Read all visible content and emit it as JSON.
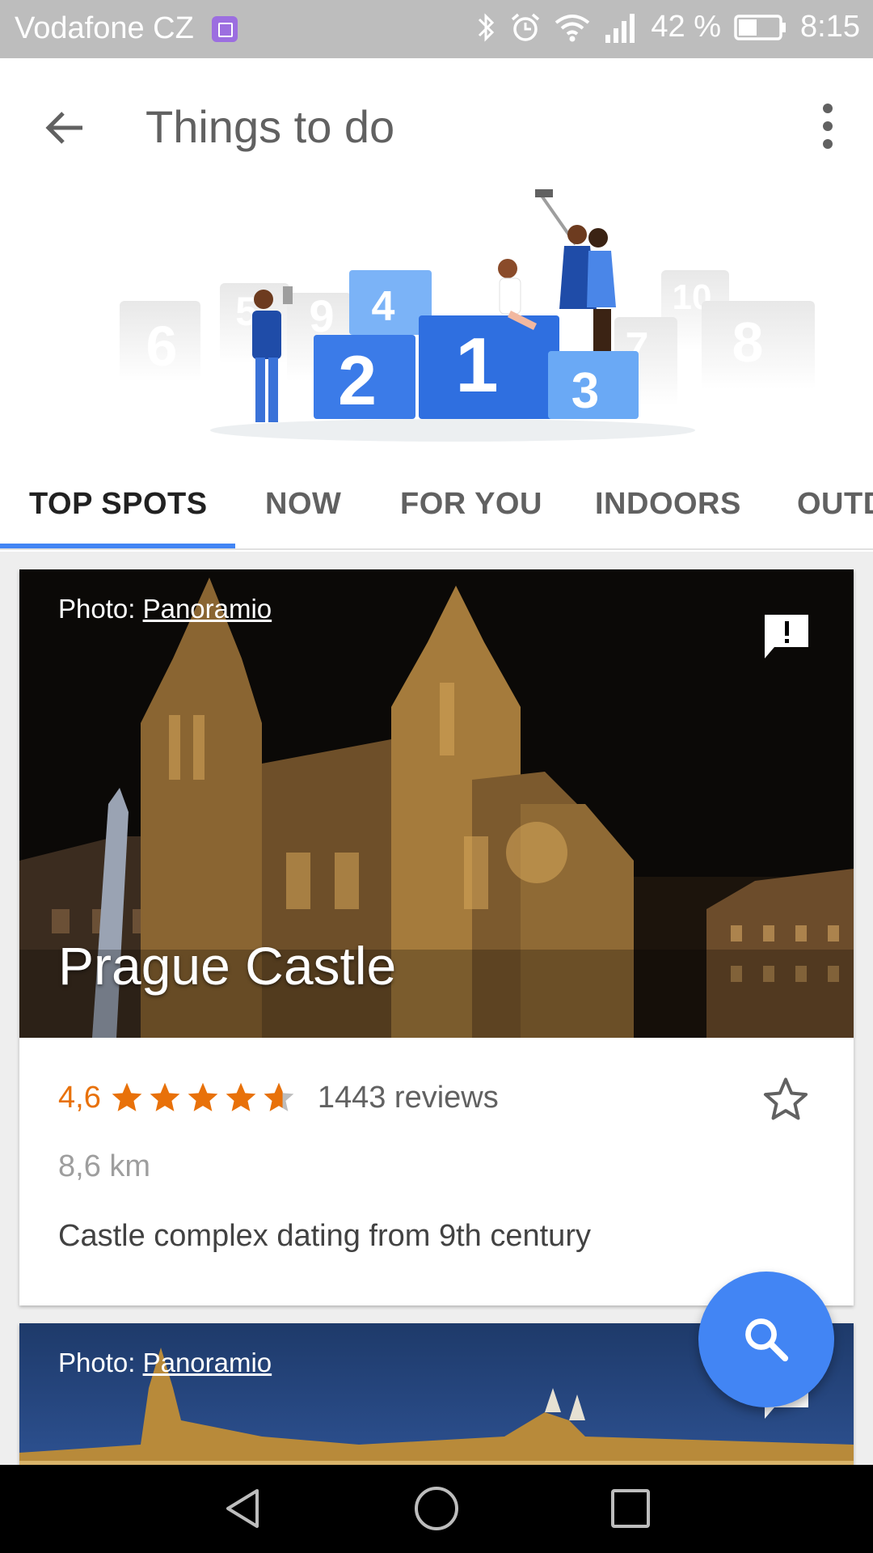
{
  "status_bar": {
    "carrier": "Vodafone CZ",
    "battery_percent": "42 %",
    "time": "8:15",
    "icons": [
      "gallery-icon",
      "bluetooth-icon",
      "alarm-icon",
      "wifi-icon",
      "signal-icon",
      "battery-icon"
    ]
  },
  "app_bar": {
    "title": "Things to do",
    "back_icon": "arrow-back-icon",
    "menu_icon": "more-vert-icon"
  },
  "hero": {
    "podium_numbers": [
      "1",
      "2",
      "3",
      "4",
      "5",
      "6",
      "7",
      "8",
      "9",
      "10"
    ]
  },
  "tabs": {
    "items": [
      {
        "label": "TOP SPOTS",
        "active": true
      },
      {
        "label": "NOW",
        "active": false
      },
      {
        "label": "FOR YOU",
        "active": false
      },
      {
        "label": "INDOORS",
        "active": false
      },
      {
        "label": "OUTD",
        "active": false
      }
    ],
    "accent": "#4285f4"
  },
  "cards": [
    {
      "photo_credit_prefix": "Photo: ",
      "photo_credit_link": "Panoramio",
      "title": "Prague Castle",
      "rating": "4,6",
      "stars": 4.6,
      "reviews": "1443 reviews",
      "distance": "8,6 km",
      "description": "Castle complex dating from 9th century"
    },
    {
      "photo_credit_prefix": "Photo: ",
      "photo_credit_link": "Panoramio"
    }
  ],
  "fab": {
    "icon": "search-icon",
    "color": "#4285f4"
  },
  "colors": {
    "rating": "#e8710a",
    "status_bar": "#bdbdbd"
  },
  "nav_bar": {
    "icons": [
      "back-triangle-icon",
      "home-circle-icon",
      "recents-square-icon"
    ]
  }
}
